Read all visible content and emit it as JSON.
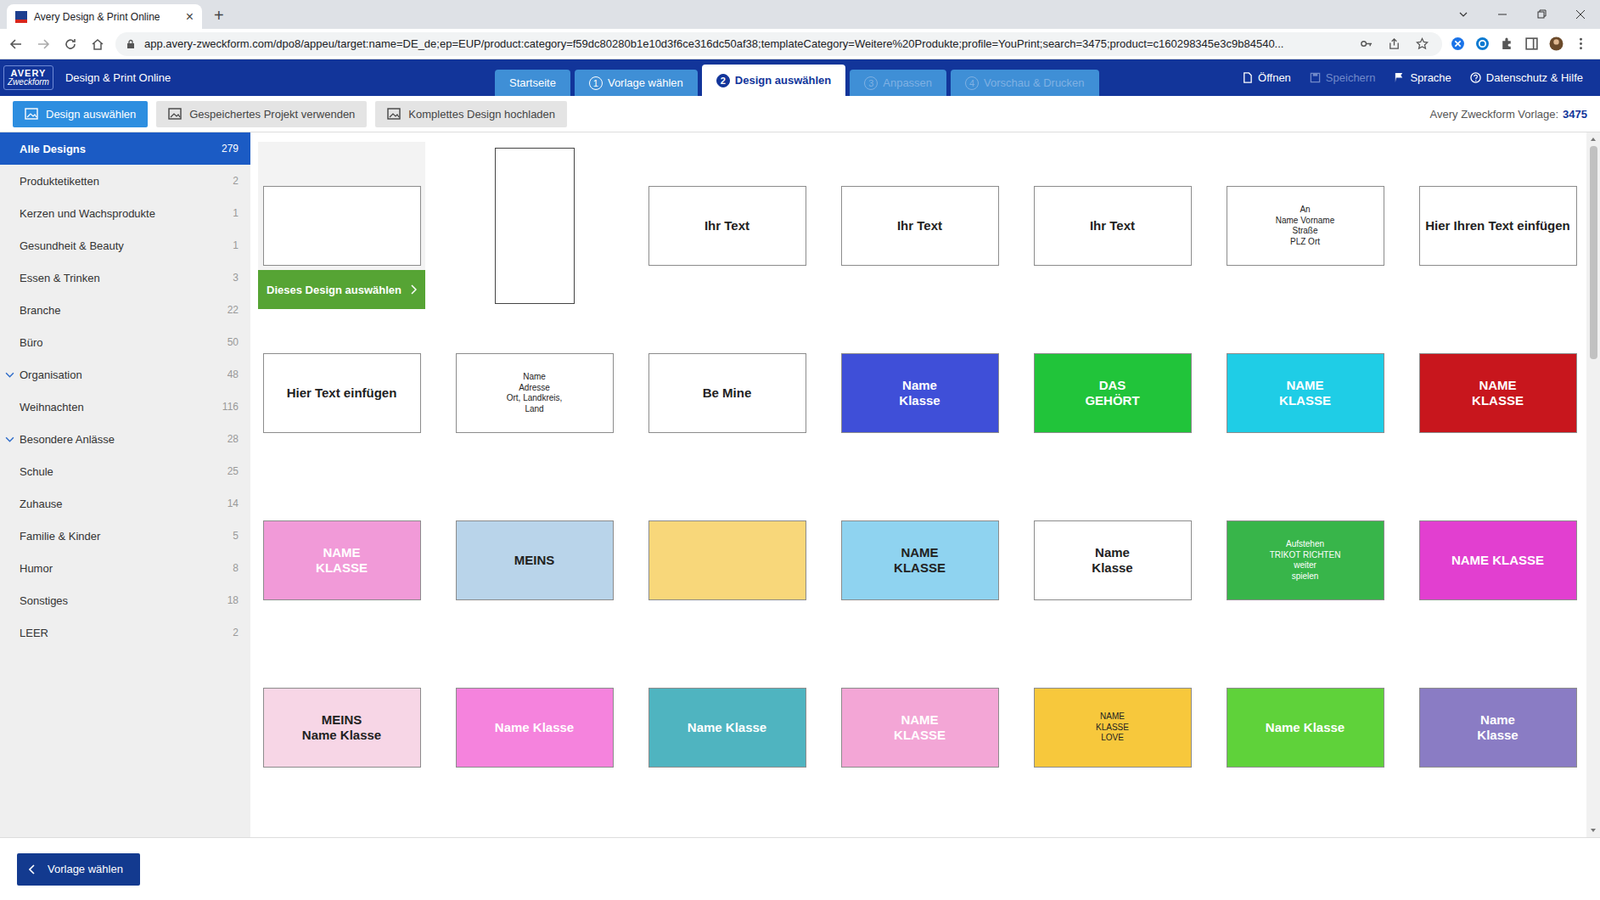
{
  "browser": {
    "tab_title": "Avery Design & Print Online",
    "tab_close": "×",
    "new_tab": "+",
    "url": "app.avery-zweckform.com/dpo8/appeu/target:name=DE_de;ep=EUP/product:category=f59dc80280b1e10d3f6ce316dc50af38;templateCategory=Weitere%20Produkte;profile=YouPrint;search=3475;product=c160298345e3c9b84540..."
  },
  "header": {
    "logo_top": "AVERY",
    "logo_bottom": "Zweckform",
    "app_name": "Design & Print Online",
    "steps": [
      {
        "number": "",
        "label": "Startseite",
        "selected": false,
        "disabled": false
      },
      {
        "number": "1",
        "label": "Vorlage wählen",
        "selected": false,
        "disabled": false
      },
      {
        "number": "2",
        "label": "Design auswählen",
        "selected": true,
        "disabled": false
      },
      {
        "number": "3",
        "label": "Anpassen",
        "selected": false,
        "disabled": true
      },
      {
        "number": "4",
        "label": "Vorschau & Drucken",
        "selected": false,
        "disabled": true
      }
    ],
    "actions": [
      {
        "label": "Öffnen",
        "disabled": false
      },
      {
        "label": "Speichern",
        "disabled": true
      },
      {
        "label": "Sprache",
        "disabled": false
      },
      {
        "label": "Datenschutz & Hilfe",
        "disabled": false
      }
    ]
  },
  "toolbar": {
    "buttons": [
      {
        "label": "Design auswählen",
        "selected": true
      },
      {
        "label": "Gespeichertes Projekt verwenden",
        "selected": false
      },
      {
        "label": "Komplettes Design hochladen",
        "selected": false
      }
    ],
    "template_label": "Avery Zweckform Vorlage:",
    "template_number": "3475"
  },
  "sidebar": {
    "items": [
      {
        "label": "Alle Designs",
        "count": "279",
        "selected": true,
        "expanded": false
      },
      {
        "label": "Produktetiketten",
        "count": "2",
        "selected": false,
        "expanded": false
      },
      {
        "label": "Kerzen und Wachsprodukte",
        "count": "1",
        "selected": false,
        "expanded": false
      },
      {
        "label": "Gesundheit & Beauty",
        "count": "1",
        "selected": false,
        "expanded": false
      },
      {
        "label": "Essen & Trinken",
        "count": "3",
        "selected": false,
        "expanded": false
      },
      {
        "label": "Branche",
        "count": "22",
        "selected": false,
        "expanded": false
      },
      {
        "label": "Büro",
        "count": "50",
        "selected": false,
        "expanded": false
      },
      {
        "label": "Organisation",
        "count": "48",
        "selected": false,
        "expanded": true
      },
      {
        "label": "Weihnachten",
        "count": "116",
        "selected": false,
        "expanded": false
      },
      {
        "label": "Besondere Anlässe",
        "count": "28",
        "selected": false,
        "expanded": true
      },
      {
        "label": "Schule",
        "count": "25",
        "selected": false,
        "expanded": false
      },
      {
        "label": "Zuhause",
        "count": "14",
        "selected": false,
        "expanded": false
      },
      {
        "label": "Familie & Kinder",
        "count": "5",
        "selected": false,
        "expanded": false
      },
      {
        "label": "Humor",
        "count": "8",
        "selected": false,
        "expanded": false
      },
      {
        "label": "Sonstiges",
        "count": "18",
        "selected": false,
        "expanded": false
      },
      {
        "label": "LEER",
        "count": "2",
        "selected": false,
        "expanded": false
      }
    ]
  },
  "select_button": "Dieses Design auswählen",
  "designs": [
    {
      "kind": "blank",
      "selected": true,
      "color": "#ffffff",
      "lines": []
    },
    {
      "kind": "portrait",
      "selected": false,
      "color": "#ffffff",
      "lines": []
    },
    {
      "kind": "design",
      "selected": false,
      "color": "#ffffff",
      "lines": [
        "Ihr Text"
      ]
    },
    {
      "kind": "design",
      "selected": false,
      "color": "#ffffff",
      "lines": [
        "Ihr Text"
      ]
    },
    {
      "kind": "design",
      "selected": false,
      "color": "#ffffff",
      "lines": [
        "Ihr Text"
      ]
    },
    {
      "kind": "design",
      "selected": false,
      "color": "#ffffff",
      "lines": [
        "An",
        "Name Vorname",
        "Straße",
        "PLZ Ort"
      ]
    },
    {
      "kind": "design",
      "selected": false,
      "color": "#ffffff",
      "lines": [
        "Hier Ihren Text einfügen"
      ]
    },
    {
      "kind": "design",
      "selected": false,
      "color": "#ffffff",
      "lines": [
        "Hier Text einfügen"
      ]
    },
    {
      "kind": "design",
      "selected": false,
      "color": "#ffffff",
      "lines": [
        "Name",
        "Adresse",
        "Ort, Landkreis,",
        "Land"
      ]
    },
    {
      "kind": "design",
      "selected": false,
      "color": "#ffffff",
      "lines": [
        "Be Mine"
      ]
    },
    {
      "kind": "design",
      "selected": false,
      "color": "#3f4fd8",
      "lines": [
        "Name",
        "Klasse"
      ]
    },
    {
      "kind": "design",
      "selected": false,
      "color": "#21c43a",
      "lines": [
        "DAS",
        "GEHÖRT"
      ]
    },
    {
      "kind": "design",
      "selected": false,
      "color": "#1fcde6",
      "lines": [
        "NAME",
        "KLASSE"
      ]
    },
    {
      "kind": "design",
      "selected": false,
      "color": "#c8161d",
      "lines": [
        "NAME",
        "KLASSE"
      ]
    },
    {
      "kind": "design",
      "selected": false,
      "color": "#f19ad8",
      "lines": [
        "NAME",
        "KLASSE"
      ]
    },
    {
      "kind": "design",
      "selected": false,
      "color": "#b9d4ea",
      "lines": [
        "MEINS"
      ]
    },
    {
      "kind": "design",
      "selected": false,
      "color": "#f8d77a",
      "lines": []
    },
    {
      "kind": "design",
      "selected": false,
      "color": "#8fd3f0",
      "lines": [
        "NAME",
        "KLASSE"
      ]
    },
    {
      "kind": "design",
      "selected": false,
      "color": "#ffffff",
      "lines": [
        "Name",
        "Klasse"
      ]
    },
    {
      "kind": "design",
      "selected": false,
      "color": "#38b54a",
      "lines": [
        "Aufstehen",
        "TRIKOT RICHTEN",
        "weiter",
        "spielen"
      ]
    },
    {
      "kind": "design",
      "selected": false,
      "color": "#e23fd0",
      "lines": [
        "NAME KLASSE"
      ]
    },
    {
      "kind": "design",
      "selected": false,
      "color": "#f7d6e6",
      "lines": [
        "MEINS",
        "Name Klasse"
      ]
    },
    {
      "kind": "design",
      "selected": false,
      "color": "#f583dd",
      "lines": [
        "Name Klasse"
      ]
    },
    {
      "kind": "design",
      "selected": false,
      "color": "#4fb4c0",
      "lines": [
        "Name Klasse"
      ]
    },
    {
      "kind": "design",
      "selected": false,
      "color": "#f3a6d6",
      "lines": [
        "NAME",
        "KLASSE"
      ]
    },
    {
      "kind": "design",
      "selected": false,
      "color": "#f7c83c",
      "lines": [
        "NAME",
        "KLASSE",
        "LOVE"
      ]
    },
    {
      "kind": "design",
      "selected": false,
      "color": "#5fd23a",
      "lines": [
        "Name Klasse"
      ]
    },
    {
      "kind": "design",
      "selected": false,
      "color": "#8a7cc4",
      "lines": [
        "Name",
        "Klasse"
      ]
    }
  ],
  "footer": {
    "back_button": "Vorlage wählen"
  }
}
